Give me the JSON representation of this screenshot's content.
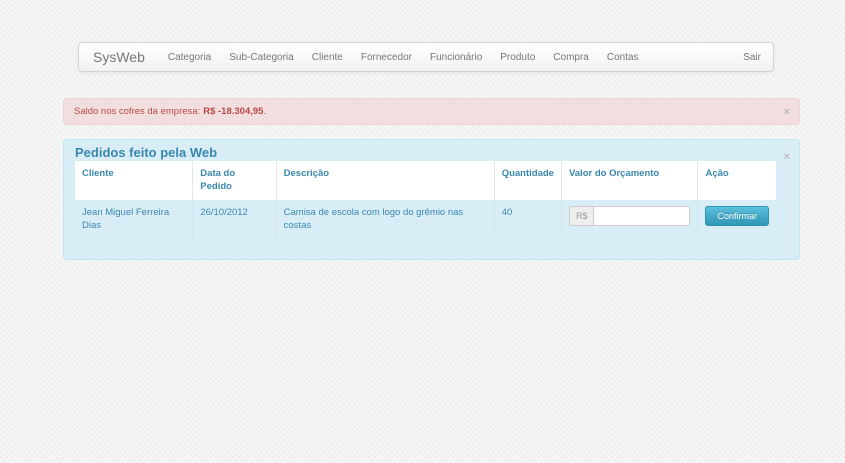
{
  "navbar": {
    "brand": "SysWeb",
    "items": [
      "Categoria",
      "Sub-Categoria",
      "Cliente",
      "Fornecedor",
      "Funcionário",
      "Produto",
      "Compra",
      "Contas"
    ],
    "logout": "Sair"
  },
  "alert": {
    "text": "Saldo nos cofres da empresa:",
    "amount": "R$ -18.304,95",
    "close": "×"
  },
  "panel": {
    "title": "Pedidos feito pela Web",
    "close": "×"
  },
  "table": {
    "headers": [
      "Cliente",
      "Data do Pedido",
      "Descrição",
      "Quantidade",
      "Valor do Orçamento",
      "Ação"
    ],
    "rows": [
      {
        "cliente": "Jean Miguel Ferreira Dias",
        "data": "26/10/2012",
        "descricao": "Camisa de escola com logo do grêmio nas costas",
        "quantidade": "40",
        "currency": "R$",
        "valor": "",
        "action": "Confirmar"
      }
    ]
  }
}
